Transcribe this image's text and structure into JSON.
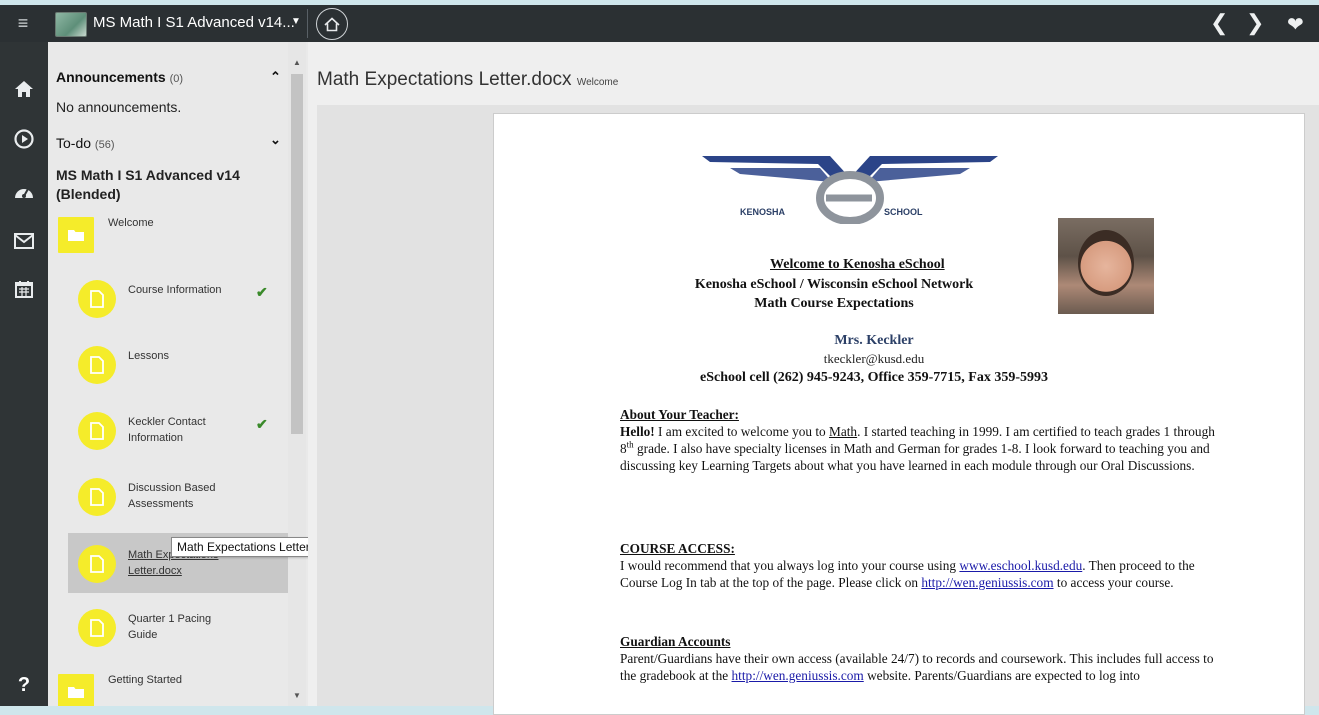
{
  "topbar": {
    "course_title": "MS Math I S1 Advanced v14...",
    "menu_icon": "hamburger-icon",
    "home_icon": "home-icon",
    "prev_icon": "chevron-left-icon",
    "next_icon": "chevron-right-icon",
    "favorite_icon": "heart-icon"
  },
  "leftrail": {
    "items": [
      "home-icon",
      "play-icon",
      "dashboard-icon",
      "mail-icon",
      "calendar-icon"
    ],
    "help_label": "?"
  },
  "sidebar": {
    "announcements_label": "Announcements",
    "announcements_count": "(0)",
    "no_announcements": "No announcements.",
    "todo_label": "To-do",
    "todo_count": "(56)",
    "course_name": "MS Math I S1 Advanced v14 (Blended)",
    "folders": [
      {
        "label": "Welcome"
      },
      {
        "label": "Getting Started"
      }
    ],
    "items": [
      {
        "label": "Course Information",
        "checked": true
      },
      {
        "label": "Lessons",
        "checked": false
      },
      {
        "label": "Keckler Contact Information",
        "checked": true
      },
      {
        "label": "Discussion Based Assessments",
        "checked": false
      },
      {
        "label": "Math Expectations Letter.docx",
        "checked": false,
        "active": true
      },
      {
        "label": "Quarter 1 Pacing Guide",
        "checked": false
      }
    ],
    "tooltip": "Math Expectations Letter.docx"
  },
  "main": {
    "doc_title": "Math Expectations Letter.docx",
    "doc_subtitle": "Welcome"
  },
  "letter": {
    "logo_left": "KENOSHA",
    "logo_right": "SCHOOL",
    "welcome_heading": "Welcome to Kenosha eSchool",
    "subheading_1": "Kenosha eSchool / Wisconsin eSchool Network",
    "subheading_2": "Math Course Expectations",
    "teacher_name": "Mrs. Keckler",
    "teacher_email": "tkeckler@kusd.edu",
    "contact_line": "eSchool cell (262) 945-9243, Office 359-7715, Fax 359-5993",
    "about_heading": "About Your Teacher:",
    "about_hello": "Hello!",
    "about_text_a": " I am excited to welcome you to ",
    "about_math": "Math",
    "about_text_b": ".  I started teaching in 1999.  I am certified to teach grades 1 through 8",
    "about_sup": "th",
    "about_text_c": " grade.  I also have specialty licenses in Math and German for grades 1-8.  I look forward to teaching you and discussing key Learning Targets about what you have learned in each module through our Oral Discussions.",
    "access_heading": "COURSE ACCESS:",
    "access_text_a": "I would recommend that you always log into your course using ",
    "access_link_1": "www.eschool.kusd.edu",
    "access_text_b": ".  Then proceed to the Course Log In tab at the top of the page.  Please click on ",
    "access_link_2": "http://wen.geniussis.com",
    "access_text_c": " to access your course.",
    "guardian_heading": "Guardian Accounts",
    "guardian_text_a": "Parent/Guardians have their own access (available 24/7) to records and coursework.  This includes full access to the gradebook at the ",
    "guardian_link": "http://wen.geniussis.com",
    "guardian_text_b": " website. Parents/Guardians are expected to log into"
  }
}
